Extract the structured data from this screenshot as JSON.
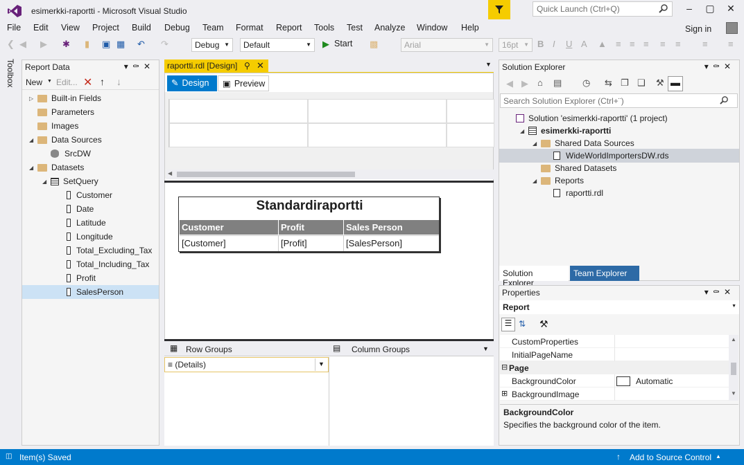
{
  "window": {
    "title": "esimerkki-raportti - Microsoft Visual Studio",
    "quick_launch_placeholder": "Quick Launch (Ctrl+Q)"
  },
  "menu": [
    "File",
    "Edit",
    "View",
    "Project",
    "Build",
    "Debug",
    "Team",
    "Format",
    "Report",
    "Tools",
    "Test",
    "Analyze",
    "Window",
    "Help"
  ],
  "signin": "Sign in",
  "toolbar": {
    "config": "Debug",
    "platform": "Default",
    "start": "Start",
    "font": "Arial",
    "size": "16pt"
  },
  "toolbox_label": "Toolbox",
  "report_data": {
    "title": "Report Data",
    "new_label": "New",
    "edit_label": "Edit...",
    "tree": [
      {
        "label": "Built-in Fields",
        "kind": "folder",
        "level": 0,
        "toggle": "▷"
      },
      {
        "label": "Parameters",
        "kind": "folder",
        "level": 0,
        "toggle": ""
      },
      {
        "label": "Images",
        "kind": "folder",
        "level": 0,
        "toggle": ""
      },
      {
        "label": "Data Sources",
        "kind": "folder",
        "level": 0,
        "toggle": "◢"
      },
      {
        "label": "SrcDW",
        "kind": "db",
        "level": 1,
        "toggle": ""
      },
      {
        "label": "Datasets",
        "kind": "folder",
        "level": 0,
        "toggle": "◢"
      },
      {
        "label": "SetQuery",
        "kind": "grid",
        "level": 1,
        "toggle": "◢"
      },
      {
        "label": "Customer",
        "kind": "field",
        "level": 2,
        "toggle": ""
      },
      {
        "label": "Date",
        "kind": "field",
        "level": 2,
        "toggle": ""
      },
      {
        "label": "Latitude",
        "kind": "field",
        "level": 2,
        "toggle": ""
      },
      {
        "label": "Longitude",
        "kind": "field",
        "level": 2,
        "toggle": ""
      },
      {
        "label": "Total_Excluding_Tax",
        "kind": "field",
        "level": 2,
        "toggle": ""
      },
      {
        "label": "Total_Including_Tax",
        "kind": "field",
        "level": 2,
        "toggle": ""
      },
      {
        "label": "Profit",
        "kind": "field",
        "level": 2,
        "toggle": ""
      },
      {
        "label": "SalesPerson",
        "kind": "field",
        "level": 2,
        "toggle": "",
        "selected": true
      }
    ]
  },
  "document": {
    "tab_label": "raportti.rdl [Design]",
    "design_tab": "Design",
    "preview_tab": "Preview",
    "report_title": "Standardiraportti",
    "table_headers": [
      "Customer",
      "Profit",
      "Sales Person"
    ],
    "table_row": [
      "[Customer]",
      "[Profit]",
      "[SalesPerson]"
    ]
  },
  "groups": {
    "row_groups": "Row Groups",
    "column_groups": "Column Groups",
    "details": "(Details)"
  },
  "solution_explorer": {
    "title": "Solution Explorer",
    "search_placeholder": "Search Solution Explorer (Ctrl+¨)",
    "tree": [
      {
        "label": "Solution 'esimerkki-raportti' (1 project)",
        "level": 0,
        "toggle": "",
        "icon": "solution"
      },
      {
        "label": "esimerkki-raportti",
        "level": 1,
        "toggle": "◢",
        "icon": "project",
        "bold": true
      },
      {
        "label": "Shared Data Sources",
        "level": 2,
        "toggle": "◢",
        "icon": "folder"
      },
      {
        "label": "WideWorldImportersDW.rds",
        "level": 3,
        "toggle": "",
        "icon": "file",
        "selected": true
      },
      {
        "label": "Shared Datasets",
        "level": 2,
        "toggle": "",
        "icon": "folder"
      },
      {
        "label": "Reports",
        "level": 2,
        "toggle": "◢",
        "icon": "folder"
      },
      {
        "label": "raportti.rdl",
        "level": 3,
        "toggle": "",
        "icon": "file"
      }
    ],
    "tabs": [
      "Solution Explorer",
      "Team Explorer"
    ]
  },
  "properties": {
    "title": "Properties",
    "object": "Report",
    "rows": [
      {
        "name": "CustomProperties",
        "value": "",
        "type": "prop"
      },
      {
        "name": "InitialPageName",
        "value": "",
        "type": "prop"
      },
      {
        "name": "Page",
        "value": "",
        "type": "category"
      },
      {
        "name": "BackgroundColor",
        "value": "Automatic",
        "type": "color"
      },
      {
        "name": "BackgroundImage",
        "value": "",
        "type": "expand"
      }
    ],
    "desc_title": "BackgroundColor",
    "desc_text": "Specifies the background color of the item."
  },
  "status": {
    "left": "Item(s) Saved",
    "right": "Add to Source Control"
  }
}
